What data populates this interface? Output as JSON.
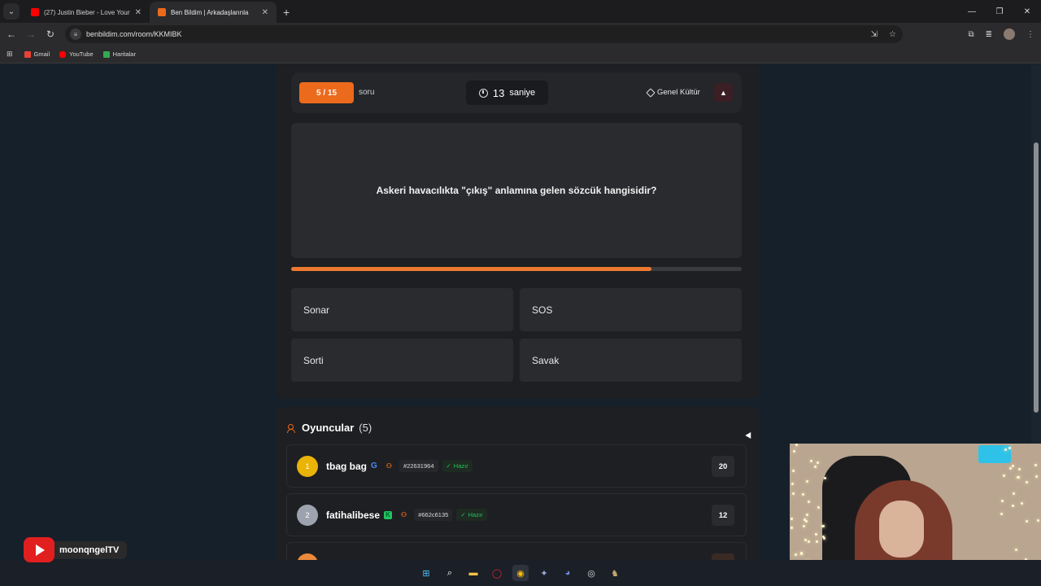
{
  "browser": {
    "tabs": [
      {
        "title": "(27) Justin Bieber - Love Yourse",
        "favicon_color": "#ff0000",
        "active": false
      },
      {
        "title": "Ben Bildim | Arkadaşlarınla",
        "favicon_color": "#ec6a1c",
        "active": true
      }
    ],
    "url": "benbildim.com/room/KKMIBK",
    "bookmarks": [
      {
        "label": "Gmail",
        "icon_color": "#ea4335"
      },
      {
        "label": "YouTube",
        "icon_color": "#ff0000"
      },
      {
        "label": "Haritalar",
        "icon_color": "#34a853"
      }
    ]
  },
  "quiz": {
    "counter": "5 / 15",
    "counter_suffix": "soru",
    "timer_value": "13",
    "timer_unit": "saniye",
    "category": "Genel Kültür",
    "question": "Askeri havacılıkta \"çıkış\" anlamına gelen sözcük hangisidir?",
    "progress_fraction": 0.8,
    "answers": [
      "Sonar",
      "SOS",
      "Sorti",
      "Savak"
    ]
  },
  "players": {
    "title": "Oyuncular",
    "count": "(5)",
    "list": [
      {
        "rank": "1",
        "name": "tbag bag",
        "badge": "G",
        "id": "#22631964",
        "status": "Hazır",
        "score": "20",
        "rank_color": "#eab308"
      },
      {
        "rank": "2",
        "name": "fatihalibese",
        "badge": "K",
        "id": "#662c6135",
        "status": "Hazır",
        "score": "12",
        "rank_color": "#9ca3af"
      }
    ]
  },
  "overlay": {
    "channel_name": "moonqngelTV"
  },
  "colors": {
    "accent": "#ec6a1c",
    "ready": "#22c55e",
    "page_bg": "#15202b",
    "card_bg": "#1e1f22"
  }
}
